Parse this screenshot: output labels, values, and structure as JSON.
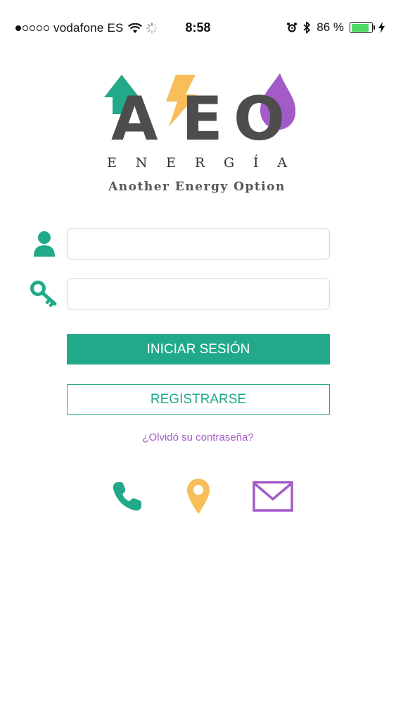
{
  "status_bar": {
    "carrier": "vodafone ES",
    "time": "8:58",
    "battery_percent": "86 %",
    "battery_level": 0.86,
    "signal_bars_filled": 1,
    "signal_bars_total": 5
  },
  "logo": {
    "letters": [
      "A",
      "E",
      "O"
    ],
    "word_letters": [
      "E",
      "N",
      "E",
      "R",
      "G",
      "Í",
      "A"
    ],
    "tagline": "Another Energy Option"
  },
  "form": {
    "username": {
      "value": "",
      "placeholder": ""
    },
    "password": {
      "value": "",
      "placeholder": ""
    },
    "login_label": "INICIAR SESIÓN",
    "register_label": "REGISTRARSE",
    "forgot_label": "¿Olvidó su contraseña?"
  },
  "contact": {
    "phone_icon": "phone-icon",
    "location_icon": "location-pin-icon",
    "email_icon": "envelope-icon"
  },
  "colors": {
    "brand_green": "#21a98a",
    "brand_yellow": "#f7be5a",
    "brand_purple": "#a35bc8",
    "logo_gray": "#4d4d4d"
  }
}
